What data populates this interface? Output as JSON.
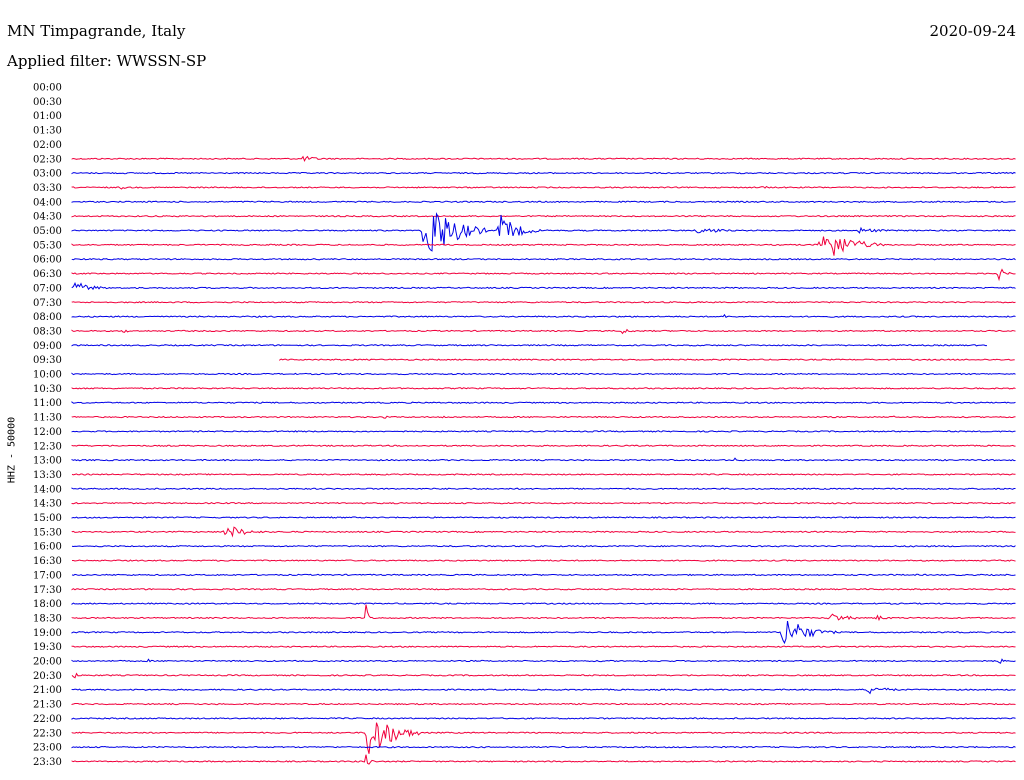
{
  "header": {
    "station": "MN Timpagrande, Italy",
    "date": "2020-09-24",
    "filter": "Applied filter: WWSSN-SP"
  },
  "chart_data": {
    "type": "line",
    "title": "MN Timpagrande, Italy",
    "ylabel": "HHZ - 50000",
    "series_colors": [
      "#0000e6",
      "#f0003c"
    ],
    "rows": [
      {
        "label": "00:00",
        "color": "",
        "start": null,
        "end": null,
        "events": []
      },
      {
        "label": "00:30",
        "color": "",
        "start": null,
        "end": null,
        "events": []
      },
      {
        "label": "01:00",
        "color": "",
        "start": null,
        "end": null,
        "events": []
      },
      {
        "label": "01:30",
        "color": "",
        "start": null,
        "end": null,
        "events": []
      },
      {
        "label": "02:00",
        "color": "",
        "start": null,
        "end": null,
        "events": []
      },
      {
        "label": "02:30",
        "color": "#f0003c",
        "start": 0.0,
        "end": 1.0,
        "events": [
          {
            "at": 0.24,
            "dur": 0.05,
            "amp": 3
          }
        ]
      },
      {
        "label": "03:00",
        "color": "#0000e6",
        "start": 0.0,
        "end": 1.0,
        "events": []
      },
      {
        "label": "03:30",
        "color": "#f0003c",
        "start": 0.0,
        "end": 1.0,
        "events": [
          {
            "at": 0.05,
            "dur": 0.02,
            "amp": 2
          },
          {
            "at": 0.73,
            "dur": 0.02,
            "amp": 2
          }
        ]
      },
      {
        "label": "04:00",
        "color": "#0000e6",
        "start": 0.0,
        "end": 1.0,
        "events": []
      },
      {
        "label": "04:30",
        "color": "#f0003c",
        "start": 0.0,
        "end": 1.0,
        "events": []
      },
      {
        "label": "05:00",
        "color": "#0000e6",
        "start": 0.0,
        "end": 1.0,
        "events": [
          {
            "at": 0.37,
            "dur": 0.07,
            "amp": 38
          },
          {
            "at": 0.45,
            "dur": 0.05,
            "amp": 16
          },
          {
            "at": 0.66,
            "dur": 0.06,
            "amp": 4
          },
          {
            "at": 0.83,
            "dur": 0.06,
            "amp": 3
          }
        ]
      },
      {
        "label": "05:30",
        "color": "#f0003c",
        "start": 0.0,
        "end": 1.0,
        "events": [
          {
            "at": 0.79,
            "dur": 0.07,
            "amp": 20
          }
        ]
      },
      {
        "label": "06:00",
        "color": "#0000e6",
        "start": 0.0,
        "end": 1.0,
        "events": []
      },
      {
        "label": "06:30",
        "color": "#f0003c",
        "start": 0.0,
        "end": 1.0,
        "events": [
          {
            "at": 0.98,
            "dur": 0.02,
            "amp": 7
          }
        ]
      },
      {
        "label": "07:00",
        "color": "#0000e6",
        "start": 0.0,
        "end": 1.0,
        "events": [
          {
            "at": 0.0,
            "dur": 0.05,
            "amp": 6
          }
        ]
      },
      {
        "label": "07:30",
        "color": "#f0003c",
        "start": 0.0,
        "end": 1.0,
        "events": []
      },
      {
        "label": "08:00",
        "color": "#0000e6",
        "start": 0.0,
        "end": 1.0,
        "events": [
          {
            "at": 0.69,
            "dur": 0.005,
            "amp": 4
          }
        ]
      },
      {
        "label": "08:30",
        "color": "#f0003c",
        "start": 0.0,
        "end": 1.0,
        "events": [
          {
            "at": 0.05,
            "dur": 0.03,
            "amp": 2
          },
          {
            "at": 0.58,
            "dur": 0.03,
            "amp": 3
          }
        ]
      },
      {
        "label": "09:00",
        "color": "#0000e6",
        "start": 0.0,
        "end": 0.97,
        "events": []
      },
      {
        "label": "09:30",
        "color": "#f0003c",
        "start": 0.22,
        "end": 1.0,
        "events": []
      },
      {
        "label": "10:00",
        "color": "#0000e6",
        "start": 0.0,
        "end": 1.0,
        "events": []
      },
      {
        "label": "10:30",
        "color": "#f0003c",
        "start": 0.0,
        "end": 1.0,
        "events": []
      },
      {
        "label": "11:00",
        "color": "#0000e6",
        "start": 0.0,
        "end": 1.0,
        "events": []
      },
      {
        "label": "11:30",
        "color": "#f0003c",
        "start": 0.0,
        "end": 1.0,
        "events": [
          {
            "at": 0.33,
            "dur": 0.01,
            "amp": 2
          },
          {
            "at": 0.39,
            "dur": 0.015,
            "amp": 2
          },
          {
            "at": 0.87,
            "dur": 0.005,
            "amp": 3
          }
        ]
      },
      {
        "label": "12:00",
        "color": "#0000e6",
        "start": 0.0,
        "end": 1.0,
        "events": []
      },
      {
        "label": "12:30",
        "color": "#f0003c",
        "start": 0.0,
        "end": 1.0,
        "events": []
      },
      {
        "label": "13:00",
        "color": "#0000e6",
        "start": 0.0,
        "end": 1.0,
        "events": [
          {
            "at": 0.7,
            "dur": 0.03,
            "amp": 2
          }
        ]
      },
      {
        "label": "13:30",
        "color": "#f0003c",
        "start": 0.0,
        "end": 1.0,
        "events": []
      },
      {
        "label": "14:00",
        "color": "#0000e6",
        "start": 0.0,
        "end": 1.0,
        "events": []
      },
      {
        "label": "14:30",
        "color": "#f0003c",
        "start": 0.0,
        "end": 1.0,
        "events": []
      },
      {
        "label": "15:00",
        "color": "#0000e6",
        "start": 0.0,
        "end": 1.0,
        "events": []
      },
      {
        "label": "15:30",
        "color": "#f0003c",
        "start": 0.0,
        "end": 1.0,
        "events": [
          {
            "at": 0.16,
            "dur": 0.05,
            "amp": 8
          }
        ]
      },
      {
        "label": "16:00",
        "color": "#0000e6",
        "start": 0.0,
        "end": 1.0,
        "events": [
          {
            "at": 0.89,
            "dur": 0.004,
            "amp": 3
          }
        ]
      },
      {
        "label": "16:30",
        "color": "#f0003c",
        "start": 0.0,
        "end": 1.0,
        "events": []
      },
      {
        "label": "17:00",
        "color": "#0000e6",
        "start": 0.0,
        "end": 1.0,
        "events": []
      },
      {
        "label": "17:30",
        "color": "#f0003c",
        "start": 0.0,
        "end": 1.0,
        "events": []
      },
      {
        "label": "18:00",
        "color": "#0000e6",
        "start": 0.0,
        "end": 1.0,
        "events": []
      },
      {
        "label": "18:30",
        "color": "#f0003c",
        "start": 0.0,
        "end": 1.0,
        "events": [
          {
            "at": 0.31,
            "dur": 0.006,
            "amp": 32
          },
          {
            "at": 0.8,
            "dur": 0.05,
            "amp": 5
          },
          {
            "at": 0.85,
            "dur": 0.03,
            "amp": 3
          }
        ]
      },
      {
        "label": "19:00",
        "color": "#0000e6",
        "start": 0.0,
        "end": 1.0,
        "events": [
          {
            "at": 0.75,
            "dur": 0.06,
            "amp": 18
          }
        ]
      },
      {
        "label": "19:30",
        "color": "#f0003c",
        "start": 0.0,
        "end": 1.0,
        "events": []
      },
      {
        "label": "20:00",
        "color": "#0000e6",
        "start": 0.0,
        "end": 1.0,
        "events": [
          {
            "at": 0.08,
            "dur": 0.01,
            "amp": 2
          },
          {
            "at": 0.98,
            "dur": 0.02,
            "amp": 3
          }
        ]
      },
      {
        "label": "20:30",
        "color": "#f0003c",
        "start": 0.0,
        "end": 1.0,
        "events": [
          {
            "at": 0.0,
            "dur": 0.02,
            "amp": 3
          }
        ]
      },
      {
        "label": "21:00",
        "color": "#0000e6",
        "start": 0.0,
        "end": 1.0,
        "events": [
          {
            "at": 0.84,
            "dur": 0.06,
            "amp": 4
          }
        ]
      },
      {
        "label": "21:30",
        "color": "#f0003c",
        "start": 0.0,
        "end": 1.0,
        "events": [
          {
            "at": 0.54,
            "dur": 0.005,
            "amp": 3
          }
        ]
      },
      {
        "label": "22:00",
        "color": "#0000e6",
        "start": 0.0,
        "end": 1.0,
        "events": []
      },
      {
        "label": "22:30",
        "color": "#f0003c",
        "start": 0.0,
        "end": 1.0,
        "events": [
          {
            "at": 0.31,
            "dur": 0.06,
            "amp": 30
          }
        ]
      },
      {
        "label": "23:00",
        "color": "#0000e6",
        "start": 0.0,
        "end": 1.0,
        "events": []
      },
      {
        "label": "23:30",
        "color": "#f0003c",
        "start": 0.0,
        "end": 1.0,
        "events": [
          {
            "at": 0.31,
            "dur": 0.01,
            "amp": 14
          }
        ]
      }
    ]
  }
}
